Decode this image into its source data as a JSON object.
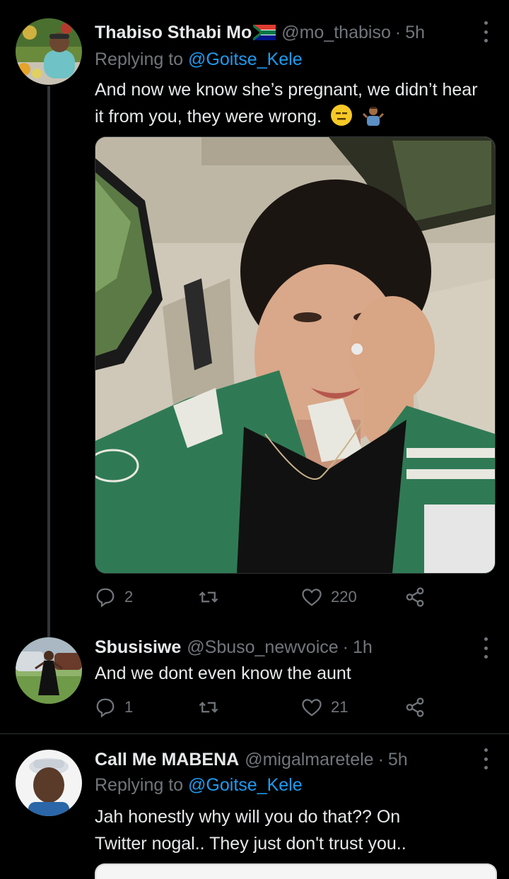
{
  "tweets": [
    {
      "name": "Thabiso Sthabi Mo",
      "handle": "@mo_thabiso",
      "separator": "·",
      "time": "5h",
      "replying_prefix": "Replying to",
      "replying_to": "@Goitse_Kele",
      "text": "And now we know she’s pregnant, we didn’t hear it from you, they were wrong.",
      "flag_icon": "south-africa-flag-icon",
      "emojis": [
        "expressionless-face-icon",
        "person-shrugging-icon"
      ],
      "stats": {
        "replies": "2",
        "retweets": "",
        "likes": "220"
      }
    },
    {
      "name": "Sbusisiwe",
      "handle": "@Sbuso_newvoice",
      "separator": "·",
      "time": "1h",
      "text": "And we dont even know the aunt",
      "stats": {
        "replies": "1",
        "retweets": "",
        "likes": "21"
      }
    },
    {
      "name": "Call Me MABENA",
      "handle": "@migalmaretele",
      "separator": "·",
      "time": "5h",
      "replying_prefix": "Replying to",
      "replying_to": "@Goitse_Kele",
      "text_line1": "Jah honestly why will you do that?? On",
      "text_line2": "Twitter nogal.. They just don't trust you.."
    }
  ],
  "colors": {
    "background": "#000000",
    "text": "#e7e9ea",
    "secondary": "#71767b",
    "link": "#1d9bf0",
    "jacket_green": "#2f7a55"
  }
}
